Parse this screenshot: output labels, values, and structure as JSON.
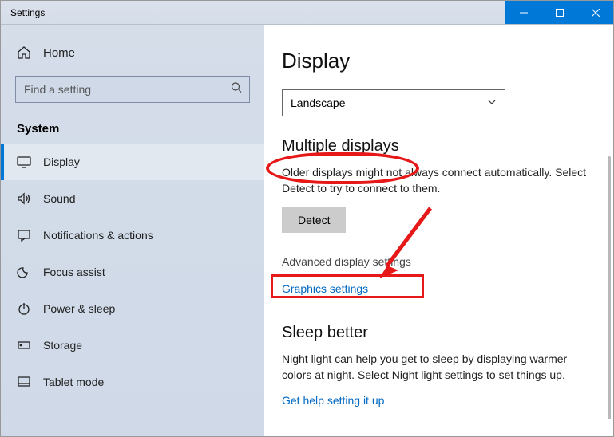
{
  "window": {
    "title": "Settings"
  },
  "sidebar": {
    "home": "Home",
    "search_placeholder": "Find a setting",
    "section": "System",
    "items": [
      {
        "label": "Display"
      },
      {
        "label": "Sound"
      },
      {
        "label": "Notifications & actions"
      },
      {
        "label": "Focus assist"
      },
      {
        "label": "Power & sleep"
      },
      {
        "label": "Storage"
      },
      {
        "label": "Tablet mode"
      }
    ]
  },
  "main": {
    "title": "Display",
    "orientation": {
      "value": "Landscape"
    },
    "multiple": {
      "heading": "Multiple displays",
      "body": "Older displays might not always connect automatically. Select Detect to try to connect to them.",
      "detect": "Detect",
      "advanced": "Advanced display settings",
      "graphics": "Graphics settings"
    },
    "sleep": {
      "heading": "Sleep better",
      "body": "Night light can help you get to sleep by displaying warmer colors at night. Select Night light settings to set things up.",
      "link": "Get help setting it up"
    }
  },
  "colors": {
    "accent": "#0078d7",
    "annotation": "#e61818"
  }
}
